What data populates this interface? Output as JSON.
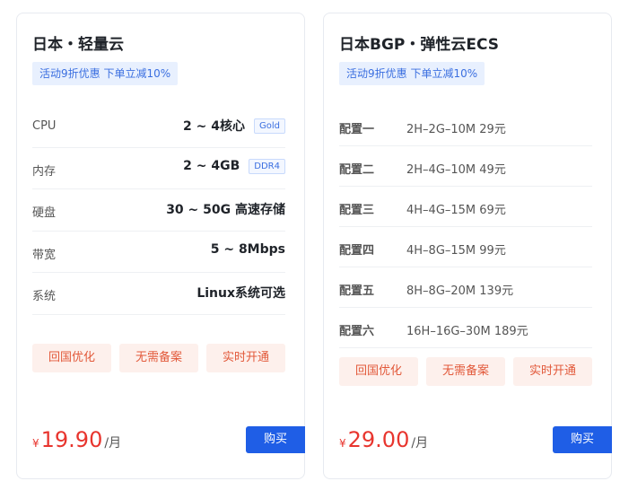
{
  "plans": [
    {
      "title": "日本・轻量云",
      "promo": "活动9折优惠 下单立减10%",
      "specs": [
        {
          "label": "CPU",
          "value": "2 ~ 4核心",
          "tag": "Gold"
        },
        {
          "label": "内存",
          "value": "2 ~ 4GB",
          "tag": "DDR4"
        },
        {
          "label": "硬盘",
          "value": "30 ~ 50G 高速存储",
          "tag": ""
        },
        {
          "label": "带宽",
          "value": "5 ~ 8Mbps",
          "tag": ""
        },
        {
          "label": "系统",
          "value": "Linux系统可选",
          "tag": ""
        }
      ],
      "features": [
        "回国优化",
        "无需备案",
        "实时开通"
      ],
      "price": {
        "currency": "¥",
        "amount": "19.90",
        "unit": "/月"
      },
      "buy_label": "购买"
    },
    {
      "title": "日本BGP・弹性云ECS",
      "promo": "活动9折优惠 下单立减10%",
      "configs": [
        {
          "label": "配置一",
          "value": "2H–2G–10M 29元"
        },
        {
          "label": "配置二",
          "value": "2H–4G–10M 49元"
        },
        {
          "label": "配置三",
          "value": "4H–4G–15M 69元"
        },
        {
          "label": "配置四",
          "value": "4H–8G–15M 99元"
        },
        {
          "label": "配置五",
          "value": "8H–8G–20M 139元"
        },
        {
          "label": "配置六",
          "value": "16H–16G–30M 189元"
        }
      ],
      "features": [
        "回国优化",
        "无需备案",
        "实时开通"
      ],
      "price": {
        "currency": "¥",
        "amount": "29.00",
        "unit": "/月"
      },
      "buy_label": "购买"
    }
  ]
}
